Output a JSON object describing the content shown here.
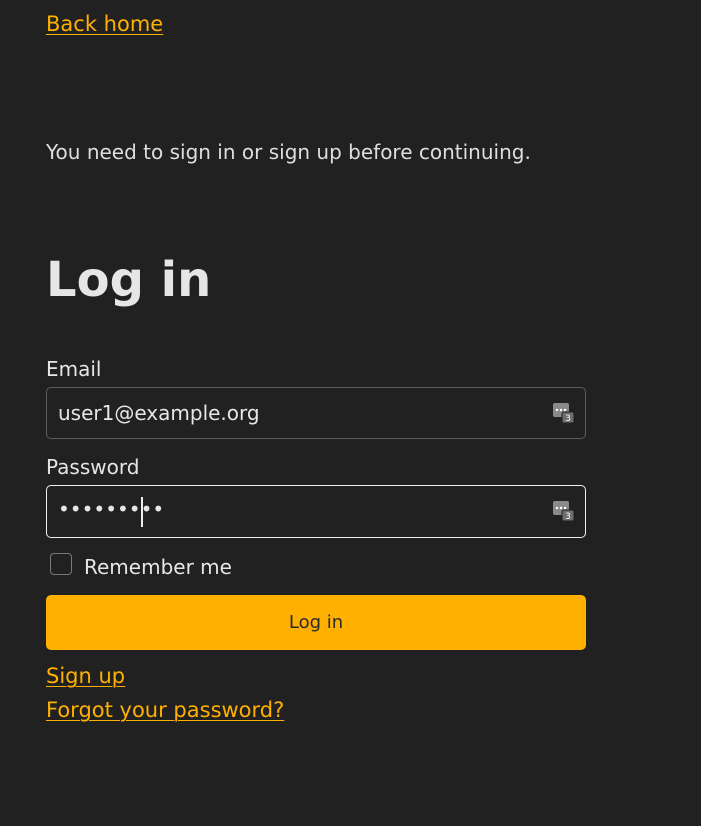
{
  "nav": {
    "back_home": "Back home"
  },
  "notice": "You need to sign in or sign up before continuing.",
  "form": {
    "title": "Log in",
    "email_label": "Email",
    "email_value": "user1@example.org",
    "password_label": "Password",
    "password_masked": "•••••••••",
    "remember_label": "Remember me",
    "remember_checked": false,
    "submit_label": "Log in"
  },
  "links": {
    "sign_up": "Sign up",
    "forgot_password": "Forgot your password?"
  },
  "colors": {
    "background": "#212121",
    "accent": "#ffb000",
    "text": "#e6e6e6"
  },
  "icons": {
    "field_icon": "password-manager-icon"
  }
}
